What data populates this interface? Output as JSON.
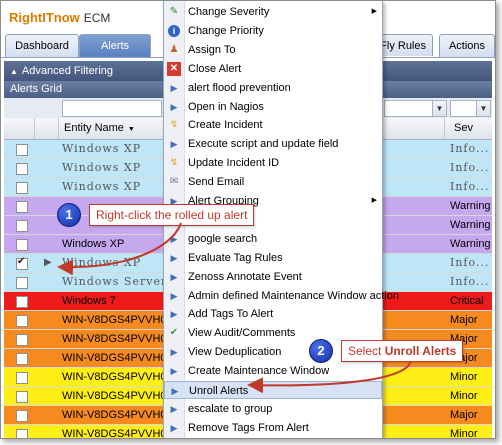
{
  "app": {
    "logo_brand": "RightITnow",
    "logo_product": "ECM"
  },
  "tabs": [
    "Dashboard",
    "Alerts",
    "Fly Rules",
    "Actions"
  ],
  "panel": {
    "advanced_filtering": "Advanced Filtering",
    "grid_title": "Alerts Grid"
  },
  "columns": {
    "entity_name": "Entity Name",
    "sev": "Sev"
  },
  "rows": [
    {
      "name": "Windows XP",
      "sev": "Info...",
      "color": "#bfe6f7",
      "mono": true,
      "checked": false
    },
    {
      "name": "Windows XP",
      "sev": "Info...",
      "color": "#bfe6f7",
      "mono": true,
      "checked": false
    },
    {
      "name": "Windows XP",
      "sev": "Info...",
      "color": "#bfe6f7",
      "mono": true,
      "checked": false
    },
    {
      "name": "",
      "sev": "Warning",
      "color": "#c6a8ef",
      "mono": false,
      "checked": false
    },
    {
      "name": "",
      "sev": "Warning",
      "color": "#c6a8ef",
      "mono": false,
      "checked": false
    },
    {
      "name": "Windows XP",
      "sev": "Warning",
      "color": "#c6a8ef",
      "mono": false,
      "checked": false
    },
    {
      "name": "Windows XP",
      "sev": "Info...",
      "color": "#bfe6f7",
      "mono": true,
      "checked": true
    },
    {
      "name": "Windows Server...",
      "sev": "Info...",
      "color": "#bfe6f7",
      "mono": true,
      "checked": false
    },
    {
      "name": "Windows 7",
      "sev": "Critical",
      "color": "#ef1a1a",
      "mono": false,
      "checked": false
    },
    {
      "name": "WIN-V8DGS4PVVH0...",
      "sev": "Major",
      "color": "#f68a1e",
      "mono": false,
      "checked": false
    },
    {
      "name": "WIN-V8DGS4PVVH0...",
      "sev": "Major",
      "color": "#f68a1e",
      "mono": false,
      "checked": false
    },
    {
      "name": "WIN-V8DGS4PVVH0...",
      "sev": "Major",
      "color": "#f68a1e",
      "mono": false,
      "checked": false
    },
    {
      "name": "WIN-V8DGS4PVVH0...",
      "sev": "Minor",
      "color": "#ffef16",
      "mono": false,
      "checked": false
    },
    {
      "name": "WIN-V8DGS4PVVH0...",
      "sev": "Minor",
      "color": "#ffef16",
      "mono": false,
      "checked": false
    },
    {
      "name": "WIN-V8DGS4PVVH0...",
      "sev": "Major",
      "color": "#f68a1e",
      "mono": false,
      "checked": false
    },
    {
      "name": "WIN-V8DGS4PVVH0...",
      "sev": "Minor",
      "color": "#ffef16",
      "mono": false,
      "checked": false
    }
  ],
  "context_menu": [
    {
      "label": "Change Severity",
      "icon": "pencil-icon",
      "submenu": true
    },
    {
      "label": "Change Priority",
      "icon": "info-icon",
      "submenu": false
    },
    {
      "label": "Assign To",
      "icon": "person-icon",
      "submenu": false
    },
    {
      "label": "Close Alert",
      "icon": "close-icon",
      "submenu": false
    },
    {
      "label": "alert flood prevention",
      "icon": "triangle-icon",
      "submenu": false
    },
    {
      "label": "Open in Nagios",
      "icon": "triangle-icon",
      "submenu": false
    },
    {
      "label": "Create Incident",
      "icon": "lightning-icon",
      "submenu": false
    },
    {
      "label": "Execute script and update field",
      "icon": "triangle-icon",
      "submenu": false
    },
    {
      "label": "Update Incident ID",
      "icon": "lightning-icon",
      "submenu": false
    },
    {
      "label": "Send Email",
      "icon": "envelope-icon",
      "submenu": false
    },
    {
      "label": "Alert Grouping",
      "icon": "triangle-icon",
      "submenu": true
    },
    {
      "label": "",
      "icon": "triangle-icon",
      "submenu": false
    },
    {
      "label": "google search",
      "icon": "triangle-icon",
      "submenu": false
    },
    {
      "label": "Evaluate Tag Rules",
      "icon": "triangle-icon",
      "submenu": false
    },
    {
      "label": "Zenoss Annotate Event",
      "icon": "triangle-icon",
      "submenu": false
    },
    {
      "label": "Admin defined Maintenance Window action",
      "icon": "triangle-icon",
      "submenu": false
    },
    {
      "label": "Add Tags To Alert",
      "icon": "triangle-icon",
      "submenu": false
    },
    {
      "label": "View Audit/Comments",
      "icon": "checkmark-icon",
      "submenu": false
    },
    {
      "label": "View Deduplication",
      "icon": "triangle-icon",
      "submenu": false
    },
    {
      "label": "Create Maintenance Window",
      "icon": "triangle-icon",
      "submenu": false
    },
    {
      "label": "Unroll Alerts",
      "icon": "triangle-icon",
      "submenu": false,
      "highlighted": true
    },
    {
      "label": "escalate to group",
      "icon": "triangle-icon",
      "submenu": false
    },
    {
      "label": "Remove Tags From Alert",
      "icon": "triangle-icon",
      "submenu": false
    }
  ],
  "callouts": {
    "one_number": "1",
    "one_text": "Right-click the rolled up alert",
    "two_number": "2",
    "two_prefix": "Select ",
    "two_bold": "Unroll Alerts"
  },
  "colors": {
    "callout_red": "#c0392b",
    "badge_blue": "#1a36b5"
  }
}
